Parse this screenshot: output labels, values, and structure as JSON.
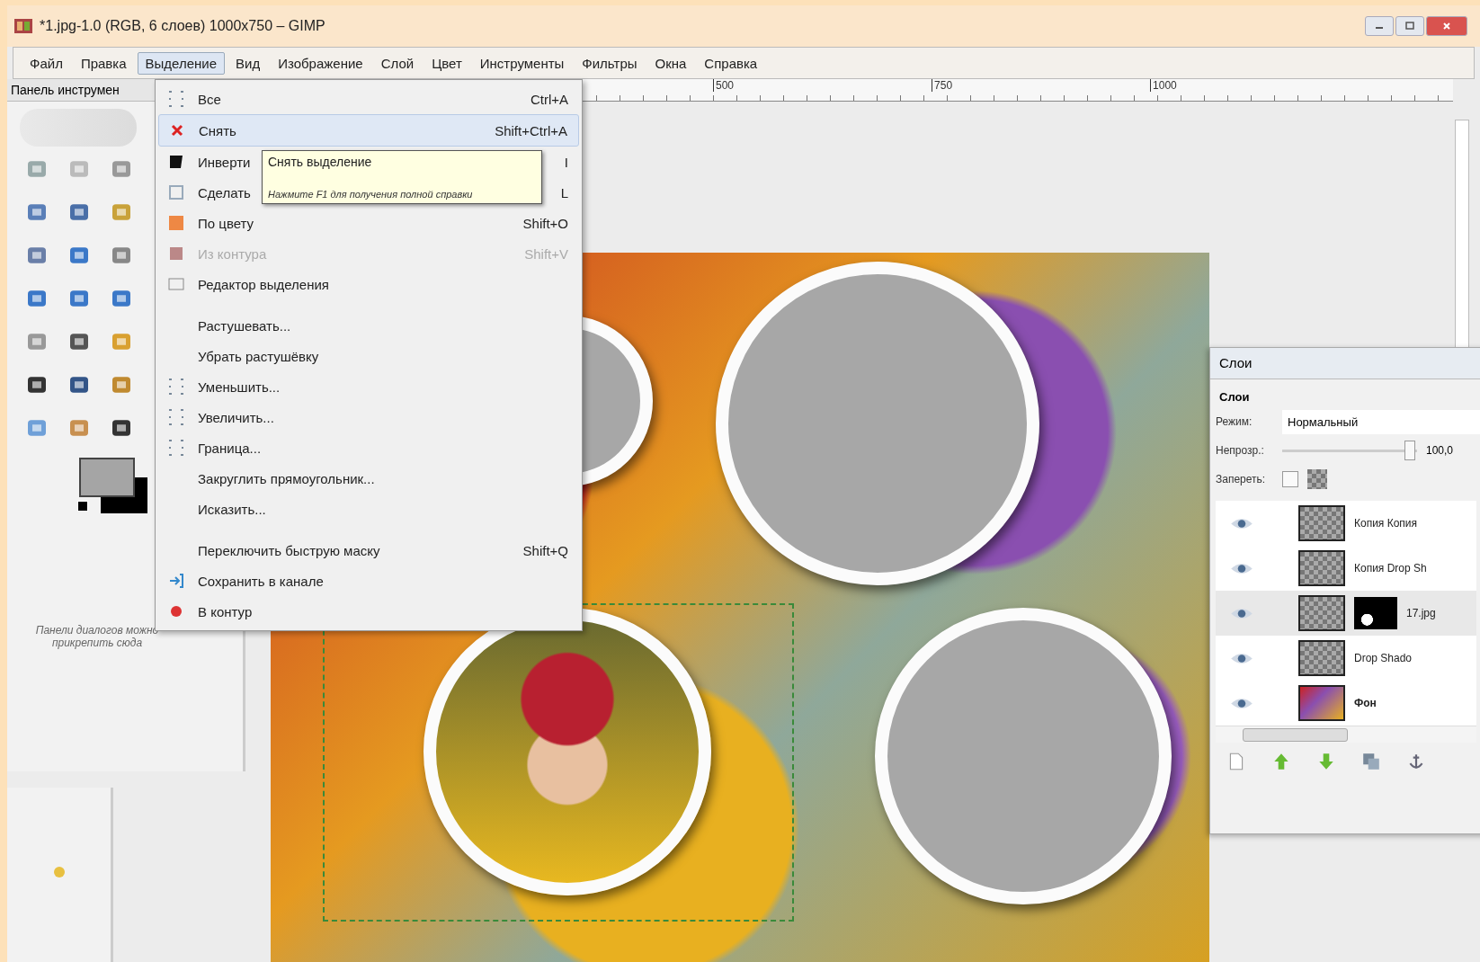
{
  "window": {
    "title": "*1.jpg-1.0 (RGB, 6 слоев) 1000x750 – GIMP"
  },
  "menubar": {
    "items": [
      {
        "label": "Файл",
        "selected": false
      },
      {
        "label": "Правка",
        "selected": false
      },
      {
        "label": "Выделение",
        "selected": true
      },
      {
        "label": "Вид",
        "selected": false
      },
      {
        "label": "Изображение",
        "selected": false
      },
      {
        "label": "Слой",
        "selected": false
      },
      {
        "label": "Цвет",
        "selected": false
      },
      {
        "label": "Инструменты",
        "selected": false
      },
      {
        "label": "Фильтры",
        "selected": false
      },
      {
        "label": "Окна",
        "selected": false
      },
      {
        "label": "Справка",
        "selected": false
      }
    ]
  },
  "toolbox": {
    "title": "Панель инструмен",
    "hint": "Панели диалогов можно прикрепить сюда"
  },
  "ruler": {
    "labels": [
      "500",
      "750",
      "1000"
    ]
  },
  "select_menu": {
    "items": [
      {
        "kind": "item",
        "label": "Все",
        "shortcut": "Ctrl+A",
        "selected": false,
        "disabled": false
      },
      {
        "kind": "item",
        "label": "Снять",
        "shortcut": "Shift+Ctrl+A",
        "selected": true,
        "disabled": false
      },
      {
        "kind": "item",
        "label": "Инверти",
        "shortcut": "I",
        "selected": false,
        "disabled": false
      },
      {
        "kind": "item",
        "label": "Сделать",
        "shortcut": "L",
        "selected": false,
        "disabled": false
      },
      {
        "kind": "item",
        "label": "По цвету",
        "shortcut": "Shift+O",
        "selected": false,
        "disabled": false
      },
      {
        "kind": "item",
        "label": "Из контура",
        "shortcut": "Shift+V",
        "selected": false,
        "disabled": true
      },
      {
        "kind": "item",
        "label": "Редактор выделения",
        "selected": false,
        "disabled": false
      },
      {
        "kind": "separator"
      },
      {
        "kind": "item",
        "label": "Растушевать...",
        "selected": false,
        "disabled": false
      },
      {
        "kind": "item",
        "label": "Убрать растушёвку",
        "selected": false,
        "disabled": false
      },
      {
        "kind": "item",
        "label": "Уменьшить...",
        "selected": false,
        "disabled": false
      },
      {
        "kind": "item",
        "label": "Увеличить...",
        "selected": false,
        "disabled": false
      },
      {
        "kind": "item",
        "label": "Граница...",
        "selected": false,
        "disabled": false
      },
      {
        "kind": "item",
        "label": "Закруглить прямоугольник...",
        "selected": false,
        "disabled": false
      },
      {
        "kind": "item",
        "label": "Исказить...",
        "selected": false,
        "disabled": false
      },
      {
        "kind": "separator"
      },
      {
        "kind": "item",
        "label": "Переключить быструю маску",
        "shortcut": "Shift+Q",
        "selected": false,
        "disabled": false
      },
      {
        "kind": "item",
        "label": "Сохранить в канале",
        "selected": false,
        "disabled": false
      },
      {
        "kind": "item",
        "label": "В контур",
        "selected": false,
        "disabled": false
      }
    ]
  },
  "tooltip": {
    "title": "Снять выделение",
    "hint": "Нажмите F1 для получения полной справки"
  },
  "layers_panel": {
    "title": "Слои",
    "tab": "Слои",
    "mode_label": "Режим:",
    "mode": "Нормальный",
    "opacity_label": "Непрозр.:",
    "opacity": {
      "level": 0.97
    },
    "opacity_value": "100,0",
    "lock_label": "Запереть:",
    "lock_pixels": {
      "checked": false
    },
    "layers": [
      {
        "name": "Копия Копия",
        "visible": true,
        "selected": false,
        "transparent": true,
        "mask": false,
        "bold": false
      },
      {
        "name": "Копия Drop Sh",
        "visible": true,
        "selected": false,
        "transparent": true,
        "mask": false,
        "bold": false
      },
      {
        "name": "17.jpg",
        "visible": true,
        "selected": true,
        "transparent": true,
        "mask": true,
        "bold": false
      },
      {
        "name": "Drop Shado",
        "visible": true,
        "selected": false,
        "transparent": true,
        "mask": false,
        "bold": false
      },
      {
        "name": "Фон",
        "visible": true,
        "selected": false,
        "transparent": false,
        "mask": false,
        "bold": true
      }
    ]
  }
}
